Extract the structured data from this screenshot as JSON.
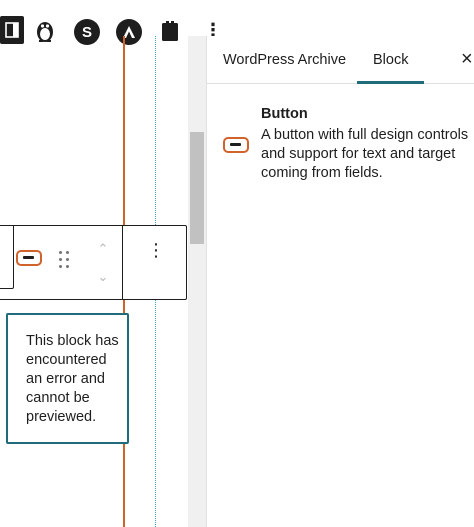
{
  "toolbar": {
    "icons": [
      "panel-toggle-icon",
      "penguin-icon",
      "s-logo-icon",
      "astra-icon",
      "clipboard-icon",
      "more-options-icon"
    ],
    "s_letter": "S",
    "more_glyph": "⋮"
  },
  "sidebar": {
    "tabs": [
      {
        "label": "WordPress Archive"
      },
      {
        "label": "Block"
      }
    ],
    "active_tab": "Block",
    "close_glyph": "×",
    "block": {
      "name": "Button",
      "description": "A button with full design controls and support for text and target coming from fields."
    }
  },
  "block_toolbar": {
    "move_up_glyph": "⌃",
    "move_down_glyph": "⌄",
    "options_glyph": "⋮"
  },
  "editor": {
    "error_message": "This block has encountered an error and cannot be previewed."
  },
  "colors": {
    "accent": "#216c7b",
    "button_icon": "#d0622b",
    "guide_line": "#d0622b",
    "dark": "#1e1e1e"
  }
}
